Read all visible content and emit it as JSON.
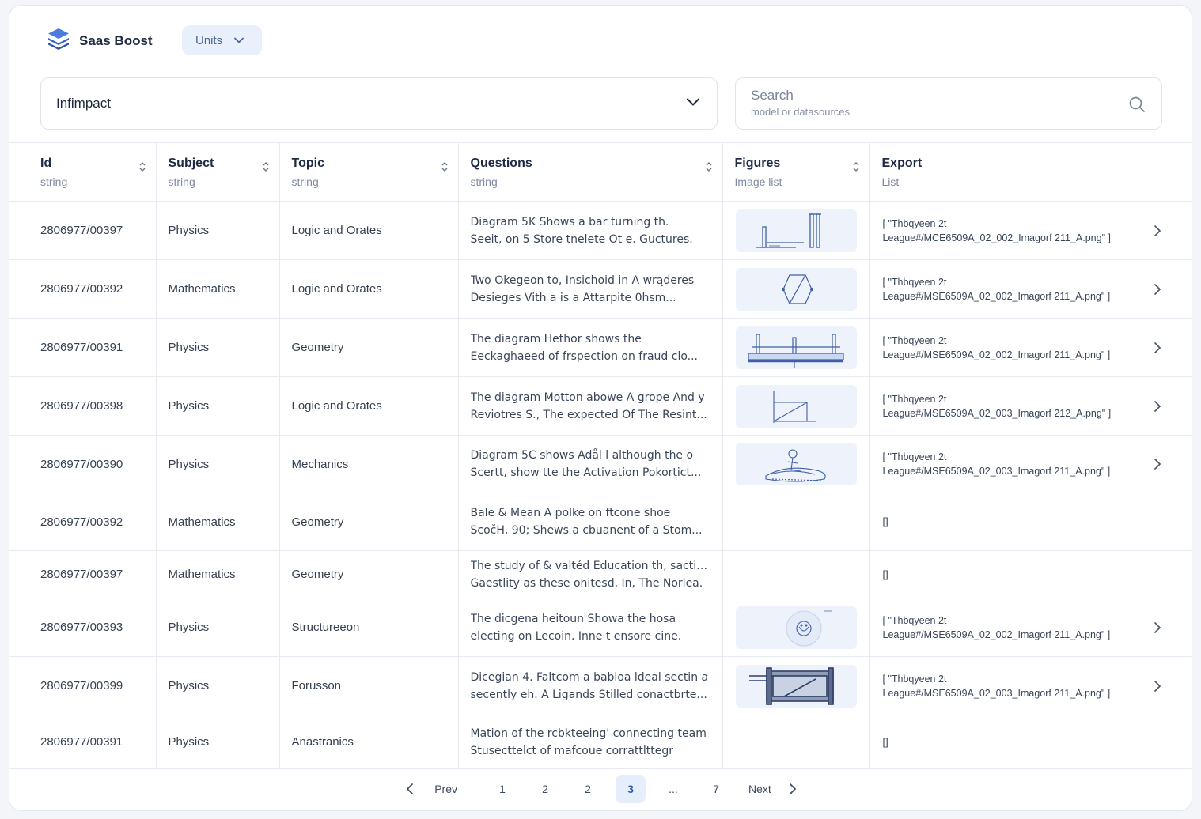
{
  "brand": {
    "name": "Saas Boost",
    "icon": "stack-layers-icon",
    "color": "#3f6fcf"
  },
  "units_button": {
    "label": "Units"
  },
  "dataset_select": {
    "value": "Infimpact"
  },
  "search": {
    "placeholder": "Search",
    "sublabel": "model or datasources"
  },
  "columns": [
    {
      "title": "Id",
      "type": "string",
      "sortable": true
    },
    {
      "title": "Subject",
      "type": "string",
      "sortable": true
    },
    {
      "title": "Topic",
      "type": "string",
      "sortable": true
    },
    {
      "title": "Questions",
      "type": "string",
      "sortable": true
    },
    {
      "title": "Figures",
      "type": "Image list",
      "sortable": true
    },
    {
      "title": "Export",
      "type": "List",
      "sortable": false
    }
  ],
  "rows": [
    {
      "id": "2806977/00397",
      "subject": "Physics",
      "topic": "Logic and Orates",
      "q1": "Diagram 5K Shows a bar turning th.",
      "q2": "Seeit, on 5 Store tnelete Ot e. Guctures.",
      "figure": "bars",
      "exp1": "[  \"Thbqyeen 2t",
      "exp2": "League#/MCE6509A_02_002_Imagorf 211_A.png\" ]"
    },
    {
      "id": "2806977/00392",
      "subject": "Mathematics",
      "topic": "Logic and Orates",
      "q1": "Two Okegeon to, Insichoid in A wrąderes",
      "q2": "Desieges Vith a is a Attarpite 0hsm...",
      "figure": "hexagon",
      "exp1": "[  \"Thbqyeen 2t",
      "exp2": "League#/MSE6509A_02_002_Imagorf 211_A.png\" ]"
    },
    {
      "id": "2806977/00391",
      "subject": "Physics",
      "topic": "Geometry",
      "q1": "The diagram Hethor shows the",
      "q2": "Eeckaghaeed of  frspection on fraud clo...",
      "figure": "frame",
      "exp1": "[  \"Thbqyeen 2t",
      "exp2": "League#/MSE6509A_02_002_Imagorf 211_A.png\" ]"
    },
    {
      "id": "2806977/00398",
      "subject": "Physics",
      "topic": "Logic and Orates",
      "q1": "The diagram Motton abowe A grope And y",
      "q2": "Reviotres S., The expected Of The Resint...",
      "figure": "triangle",
      "exp1": "[  \"Thbqyeen 2t",
      "exp2": "League#/MSE6509A_02_003_Imagorf 212_A.png\" ]"
    },
    {
      "id": "2806977/00390",
      "subject": "Physics",
      "topic": "Mechanics",
      "q1": "Diagram 5C shows Adål l although the o",
      "q2": "Scertt, show tte the Activation Pokortict...",
      "figure": "sketch",
      "exp1": "[  \"Thbqyeen 2t",
      "exp2": "League#/MSE6509A_02_003_Imagorf 211_A.png\" ]"
    },
    {
      "id": "2806977/00392",
      "subject": "Mathematics",
      "topic": "Geometry",
      "q1": "Bale & Mean A polke on ftcone shoe",
      "q2": "ScočH, 90; Shews a cbuanent of a Stom...",
      "figure": "",
      "exp1": "[]",
      "exp2": ""
    },
    {
      "id": "2806977/00397",
      "subject": "Mathematics",
      "topic": "Geometry",
      "q1": "The study of & valtéd Education th, saction",
      "q2": "Gaestlity as these onitesd, In, The Norlea.",
      "figure": "",
      "exp1": "[]",
      "exp2": ""
    },
    {
      "id": "2806977/00393",
      "subject": "Physics",
      "topic": "Structureeon",
      "q1": "The dicgena heitoun Showa the hosa",
      "q2": "electing on Lecoin. Inne t ensore cine.",
      "figure": "circle",
      "exp1": "[  \"Thbqyeen 2t",
      "exp2": "League#/MSE6509A_02_002_Imagorf 211_A.png\" ]"
    },
    {
      "id": "2806977/00399",
      "subject": "Physics",
      "topic": "Forusson",
      "q1": "Dicegian 4. Faltcom a babloa ldeal sectin a",
      "q2": "secently eh. A Ligands Stilled conactbrte...",
      "figure": "machine",
      "exp1": "[  \"Thbqyeen 2t",
      "exp2": "League#/MSE6509A_02_003_Imagorf 211_A.png\" ]"
    },
    {
      "id": "2806977/00391",
      "subject": "Physics",
      "topic": "Anastranics",
      "q1": "Mation of  the  rcbkteeing' connecting team",
      "q2": "Stusecttelct of  mafcoue corrattlttegr",
      "figure": "",
      "exp1": "[]",
      "exp2": ""
    }
  ],
  "pagination": {
    "prev": "Prev",
    "next": "Next",
    "pages": [
      "1",
      "2",
      "2",
      "3",
      "...",
      "7"
    ],
    "current_index": 3
  }
}
